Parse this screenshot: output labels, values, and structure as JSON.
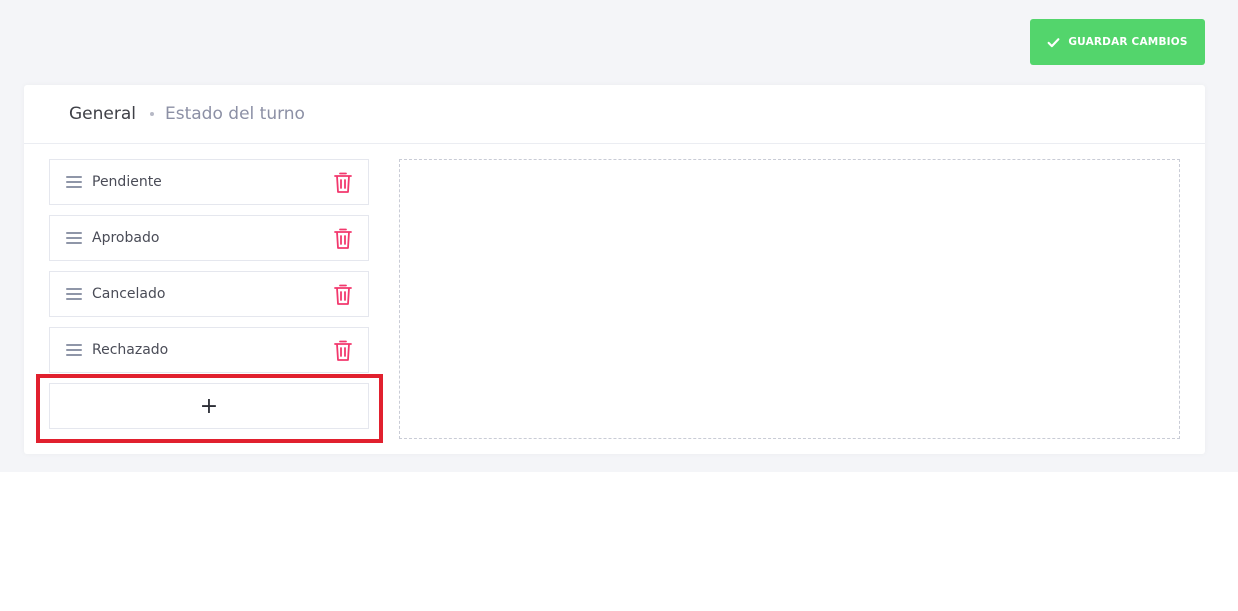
{
  "toolbar": {
    "save_label": "GUARDAR CAMBIOS",
    "save_icon": "check-icon",
    "save_color": "#53d56c"
  },
  "breadcrumb": {
    "general": "General",
    "estado": "Estado del turno"
  },
  "statuses": [
    {
      "label": "Pendiente"
    },
    {
      "label": "Aprobado"
    },
    {
      "label": "Cancelado"
    },
    {
      "label": "Rechazado"
    }
  ],
  "add_button": {
    "label": "+"
  },
  "colors": {
    "trash": "#f2386d",
    "highlight": "#e1202e"
  }
}
